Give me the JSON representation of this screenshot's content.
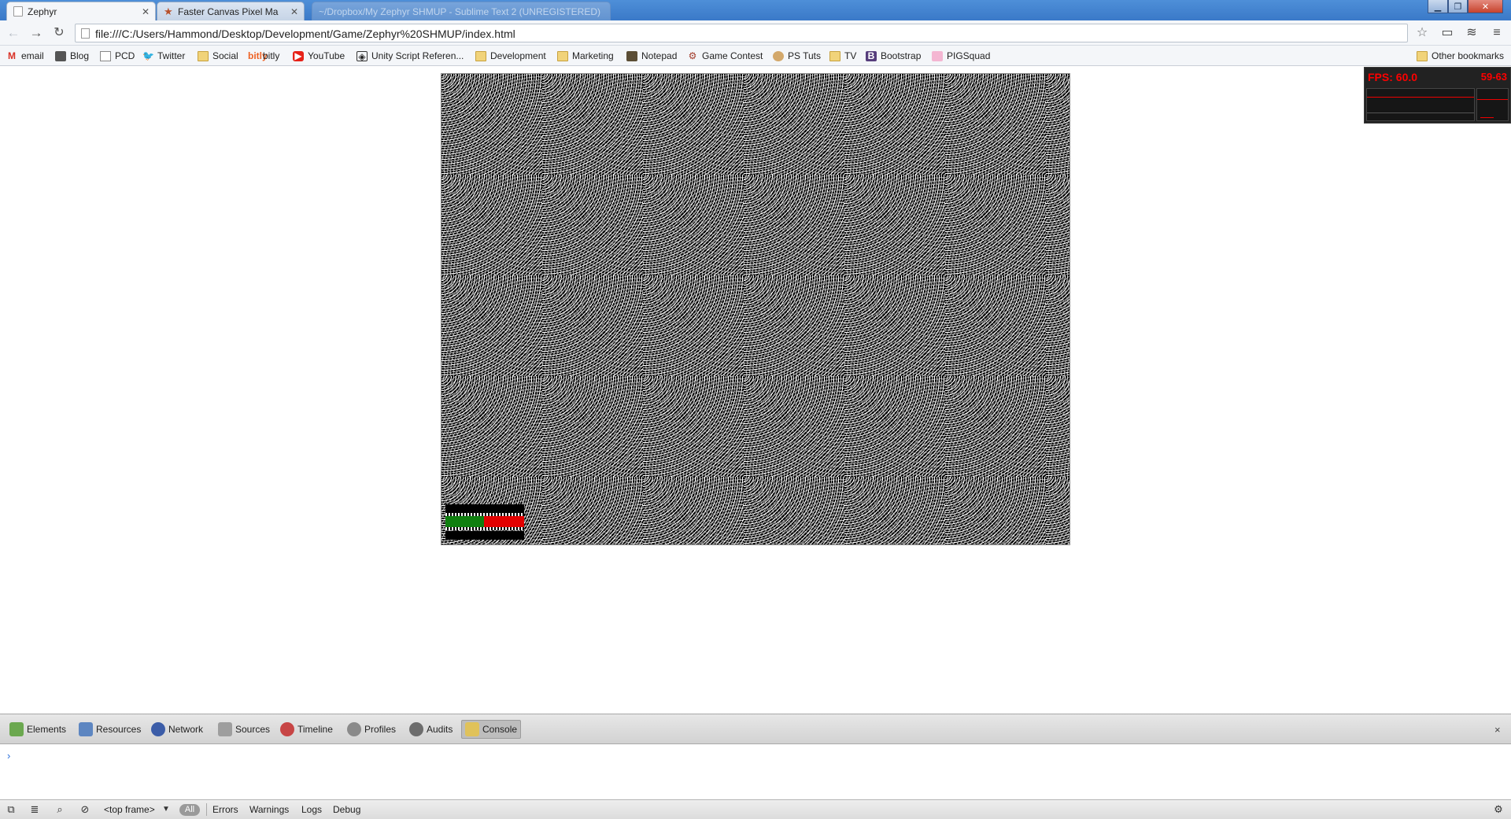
{
  "browser": {
    "tabs": [
      {
        "title": "Zephyr",
        "favicon": "page-icon",
        "active": true
      },
      {
        "title": "Faster Canvas Pixel Ma",
        "favicon": "star-icon",
        "active": false
      },
      {
        "title": "~/Dropbox/My Zephyr SHMUP - Sublime Text 2 (UNREGISTERED)",
        "favicon": "none",
        "active": false
      }
    ],
    "url": "file:///C:/Users/Hammond/Desktop/Development/Game/Zephyr%20SHMUP/index.html",
    "bookmarks": [
      {
        "label": "email",
        "icon": "gmail-icon"
      },
      {
        "label": "Blog",
        "icon": "blog-icon"
      },
      {
        "label": "PCD",
        "icon": "page-icon"
      },
      {
        "label": "Twitter",
        "icon": "twitter-icon"
      },
      {
        "label": "Social",
        "icon": "folder-icon"
      },
      {
        "label": "bitly",
        "icon": "bitly-icon"
      },
      {
        "label": "YouTube",
        "icon": "youtube-icon"
      },
      {
        "label": "Unity Script Referen...",
        "icon": "unity-icon"
      },
      {
        "label": "Development",
        "icon": "folder-icon"
      },
      {
        "label": "Marketing",
        "icon": "folder-icon"
      },
      {
        "label": "Notepad",
        "icon": "notepad-icon"
      },
      {
        "label": "Game Contest",
        "icon": "gear-icon"
      },
      {
        "label": "PS Tuts",
        "icon": "pstuts-icon"
      },
      {
        "label": "TV",
        "icon": "folder-icon"
      },
      {
        "label": "Bootstrap",
        "icon": "bootstrap-icon"
      },
      {
        "label": "PIGSquad",
        "icon": "pigsquad-icon"
      }
    ],
    "other_bookmarks": "Other bookmarks"
  },
  "game": {
    "health_fraction": 0.49,
    "health_color": "#0f7f0f",
    "damage_color": "#e20000"
  },
  "fps_meter": {
    "label": "FPS: 60.0",
    "range": "59-63",
    "color": "#ff0000"
  },
  "devtools": {
    "tabs": [
      {
        "label": "Elements",
        "icon": "elements-icon"
      },
      {
        "label": "Resources",
        "icon": "resources-icon"
      },
      {
        "label": "Network",
        "icon": "network-icon"
      },
      {
        "label": "Sources",
        "icon": "sources-icon"
      },
      {
        "label": "Timeline",
        "icon": "timeline-icon"
      },
      {
        "label": "Profiles",
        "icon": "profiles-icon"
      },
      {
        "label": "Audits",
        "icon": "audits-icon"
      },
      {
        "label": "Console",
        "icon": "console-icon",
        "active": true
      }
    ],
    "close": "×",
    "prompt": "›",
    "frame_select": "<top frame>",
    "filters": {
      "all": "All",
      "errors": "Errors",
      "warnings": "Warnings",
      "logs": "Logs",
      "debug": "Debug"
    }
  }
}
